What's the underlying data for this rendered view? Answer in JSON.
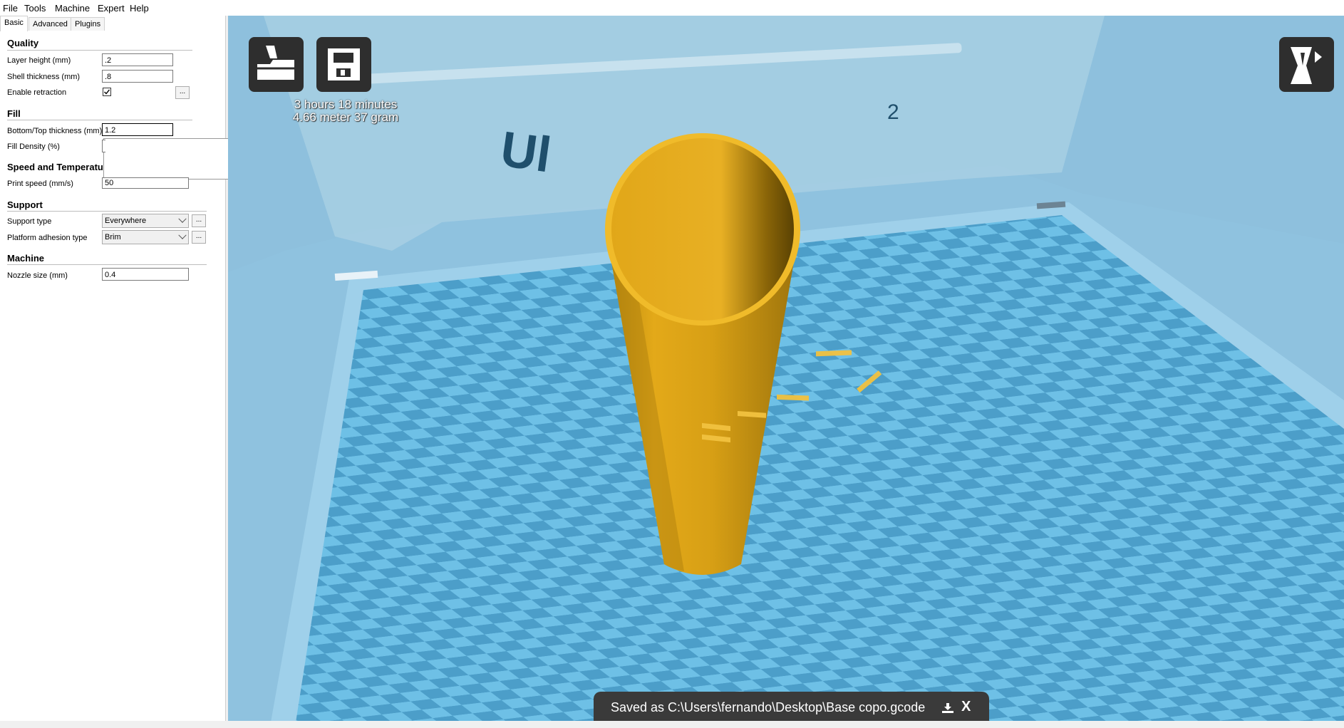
{
  "menu": [
    "File",
    "Tools",
    "Machine",
    "Expert",
    "Help"
  ],
  "tabs": [
    "Basic",
    "Advanced",
    "Plugins"
  ],
  "sections": {
    "quality": "Quality",
    "fill": "Fill",
    "speed": "Speed and Temperatu",
    "support": "Support",
    "machine": "Machine"
  },
  "fields": {
    "layer_height": {
      "label": "Layer height (mm)",
      "value": ".2"
    },
    "shell_thickness": {
      "label": "Shell thickness (mm)",
      "value": ".8"
    },
    "enable_retraction": {
      "label": "Enable retraction",
      "checked": true
    },
    "bottom_top": {
      "label": "Bottom/Top thickness (mm)",
      "value": "1.2"
    },
    "fill_density": {
      "label": "Fill Density (%)",
      "value": ""
    },
    "print_speed": {
      "label": "Print speed (mm/s)",
      "value": "50"
    },
    "support_type": {
      "label": "Support type",
      "value": "Everywhere"
    },
    "platform_adhesion": {
      "label": "Platform adhesion type",
      "value": "Brim"
    },
    "nozzle_size": {
      "label": "Nozzle size (mm)",
      "value": "0.4"
    }
  },
  "more_label": "...",
  "stats": {
    "time": "3 hours 18 minutes",
    "material": "4.66 meter 37 gram"
  },
  "toast": {
    "message": "Saved as C:\\Users\\fernando\\Desktop\\Base copo.gcode",
    "close": "X"
  },
  "colors": {
    "viewport_bg": "#8fc2df",
    "plate_light": "#6ec0e6",
    "plate_dark": "#4c9ec9",
    "model": "#e6ac1c",
    "button_bg": "#2e2e2e"
  },
  "icons": [
    "load-model-icon",
    "save-toolpath-icon",
    "view-mode-icon",
    "sd-card-icon"
  ]
}
